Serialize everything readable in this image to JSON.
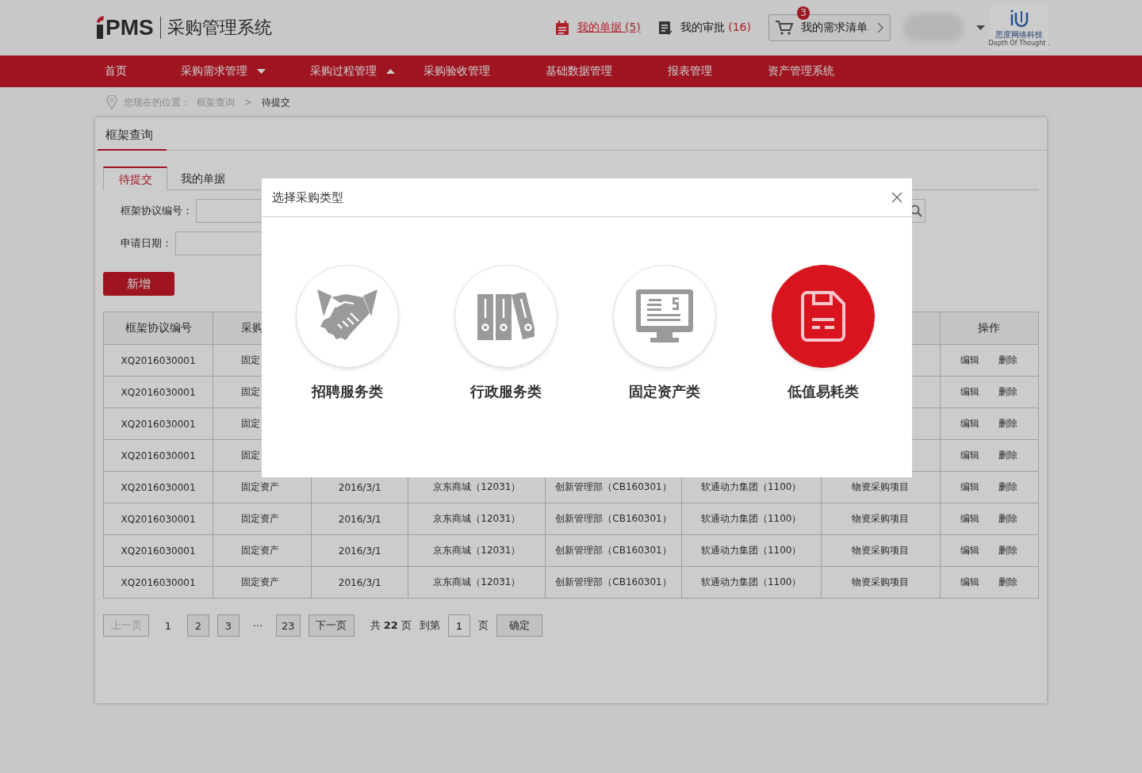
{
  "header": {
    "logo_text": "PMS",
    "system_title": "采购管理系统",
    "links": [
      {
        "label": "我的单据",
        "count": "(5)",
        "active": true
      },
      {
        "label": "我的审批",
        "count": "(16)",
        "active": false
      }
    ],
    "cart": {
      "label": "我的需求清单",
      "badge": "3"
    },
    "company": {
      "name": "思度网络科技",
      "slogan": "Depth Of Thought ."
    }
  },
  "nav": [
    {
      "label": "首页",
      "kind": "link"
    },
    {
      "label": "采购需求管理",
      "kind": "dropdown",
      "expanded": false
    },
    {
      "label": "采购过程管理",
      "kind": "dropdown",
      "expanded": true
    },
    {
      "label": "采购验收管理",
      "kind": "link"
    },
    {
      "label": "基础数据管理",
      "kind": "link"
    },
    {
      "label": "报表管理",
      "kind": "link"
    },
    {
      "label": "资产管理系统",
      "kind": "link"
    }
  ],
  "breadcrumb": {
    "prefix": "您现在的位置：",
    "items": [
      {
        "label": "框架查询",
        "current": false
      },
      {
        "label": "待提交",
        "current": true
      }
    ],
    "separator": ">"
  },
  "panel": {
    "title": "框架查询",
    "tabs": [
      {
        "label": "待提交",
        "selected": true
      },
      {
        "label": "我的单据",
        "selected": false
      }
    ],
    "filters": [
      {
        "label": "框架协议编号："
      },
      {
        "label": "申请日期："
      }
    ],
    "add_button": "新增",
    "table": {
      "columns": [
        "框架协议编号",
        "采购"
      ],
      "action_column": "操作",
      "rows": [
        {
          "cells": [
            "XQ2016030001",
            "固定"
          ],
          "actions": [
            "编辑",
            "删除"
          ]
        },
        {
          "cells": [
            "XQ2016030001",
            "固定"
          ],
          "actions": [
            "编辑",
            "删除"
          ]
        },
        {
          "cells": [
            "XQ2016030001",
            "固定"
          ],
          "actions": [
            "编辑",
            "删除"
          ]
        },
        {
          "cells": [
            "XQ2016030001",
            "固定"
          ],
          "actions": [
            "编辑",
            "删除"
          ]
        },
        {
          "cells": [
            "XQ2016030001",
            "固定资产",
            "2016/3/1",
            "京东商城（12031）",
            "创新管理部（CB160301）",
            "软通动力集团（1100）",
            "物资采购项目"
          ],
          "actions": [
            "编辑",
            "删除"
          ]
        },
        {
          "cells": [
            "XQ2016030001",
            "固定资产",
            "2016/3/1",
            "京东商城（12031）",
            "创新管理部（CB160301）",
            "软通动力集团（1100）",
            "物资采购项目"
          ],
          "actions": [
            "编辑",
            "删除"
          ]
        },
        {
          "cells": [
            "XQ2016030001",
            "固定资产",
            "2016/3/1",
            "京东商城（12031）",
            "创新管理部（CB160301）",
            "软通动力集团（1100）",
            "物资采购项目"
          ],
          "actions": [
            "编辑",
            "删除"
          ]
        },
        {
          "cells": [
            "XQ2016030001",
            "固定资产",
            "2016/3/1",
            "京东商城（12031）",
            "创新管理部（CB160301）",
            "软通动力集团（1100）",
            "物资采购项目"
          ],
          "actions": [
            "编辑",
            "删除"
          ]
        }
      ]
    },
    "pagination": {
      "prev": {
        "label": "上一页",
        "disabled": true
      },
      "pages": [
        {
          "label": "1",
          "kind": "page",
          "selected": true
        },
        {
          "label": "2",
          "kind": "page",
          "selected": false
        },
        {
          "label": "3",
          "kind": "page",
          "selected": false
        },
        {
          "label": "···",
          "kind": "ellipsis"
        },
        {
          "label": "23",
          "kind": "page",
          "selected": false
        }
      ],
      "next": {
        "label": "下一页",
        "disabled": false
      },
      "total": "共 **22** 页",
      "goto_label": "到第",
      "goto_value": "1",
      "goto_suffix": "页",
      "confirm": "确定"
    }
  },
  "modal": {
    "title": "选择采购类型",
    "options": [
      {
        "label": "招聘服务类",
        "selected": false
      },
      {
        "label": "行政服务类",
        "selected": false
      },
      {
        "label": "固定资产类",
        "selected": false
      },
      {
        "label": "低值易耗类",
        "selected": true
      }
    ]
  }
}
